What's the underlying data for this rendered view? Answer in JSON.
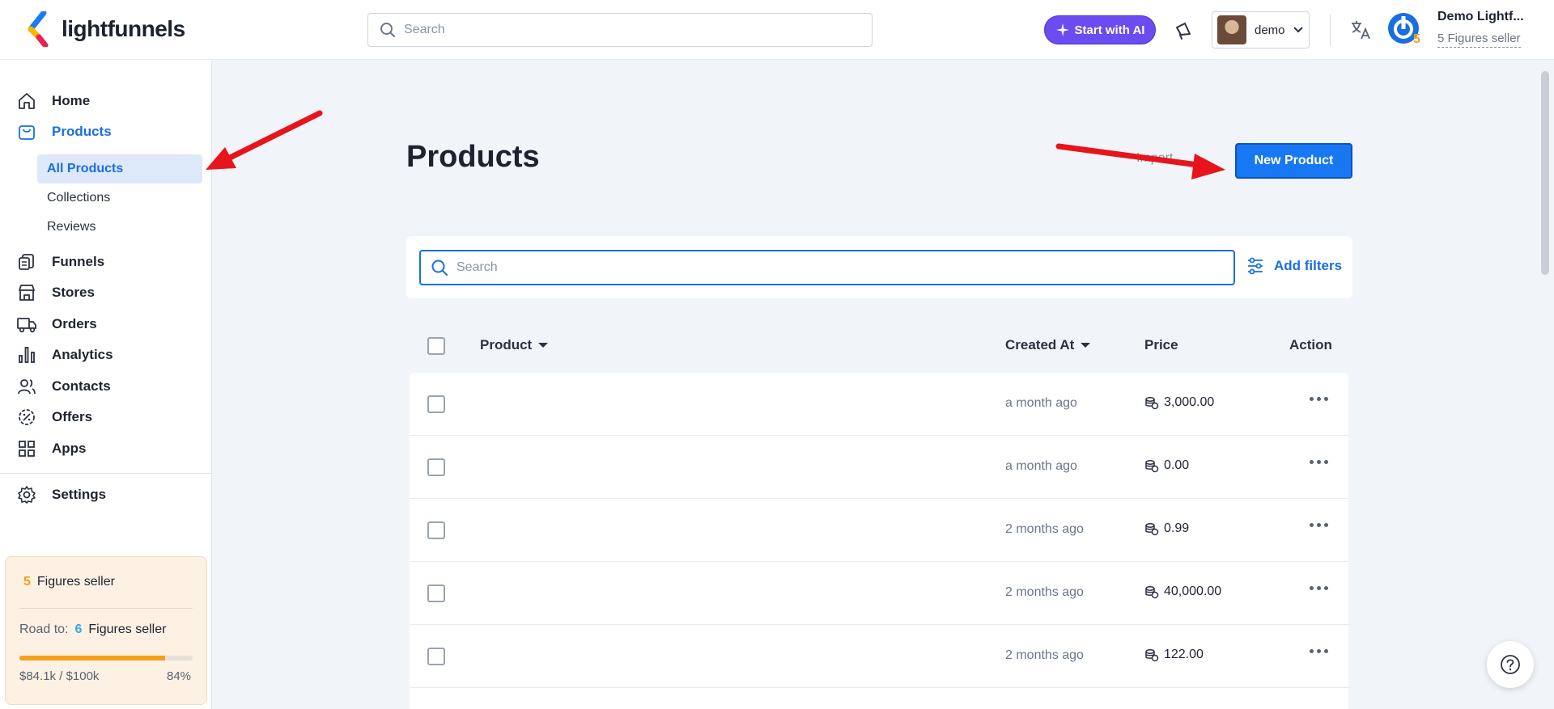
{
  "app": {
    "brand": "lightfunnels"
  },
  "topbar": {
    "search_placeholder": "Search",
    "ai_button": "Start with AI",
    "user_label": "demo",
    "account_name": "Demo Lightf...",
    "account_tier": "5 Figures seller",
    "account_badge": "5"
  },
  "sidebar": {
    "items": [
      {
        "label": "Home",
        "icon": "home-icon"
      },
      {
        "label": "Products",
        "icon": "bag-icon",
        "active": true
      },
      {
        "label": "Funnels",
        "icon": "funnels-icon"
      },
      {
        "label": "Stores",
        "icon": "store-icon"
      },
      {
        "label": "Orders",
        "icon": "truck-icon"
      },
      {
        "label": "Analytics",
        "icon": "analytics-icon"
      },
      {
        "label": "Contacts",
        "icon": "contacts-icon"
      },
      {
        "label": "Offers",
        "icon": "offers-icon"
      },
      {
        "label": "Apps",
        "icon": "apps-icon"
      },
      {
        "label": "Settings",
        "icon": "gear-icon"
      }
    ],
    "sub_items": [
      {
        "label": "All Products",
        "active": true
      },
      {
        "label": "Collections"
      },
      {
        "label": "Reviews"
      }
    ],
    "tier_card": {
      "current_num": "5",
      "current_label": "Figures seller",
      "road_label": "Road to:",
      "next_num": "6",
      "next_label": "Figures seller",
      "progress_text": "$84.1k / $100k",
      "progress_pct": "84%",
      "progress_value": 0.84
    }
  },
  "main": {
    "title": "Products",
    "import_label": "Import",
    "new_button": "New Product",
    "search_placeholder": "Search",
    "add_filters": "Add filters",
    "columns": {
      "product": "Product",
      "created_at": "Created At",
      "price": "Price",
      "action": "Action"
    },
    "rows": [
      {
        "created": "a month ago",
        "price": "3,000.00"
      },
      {
        "created": "a month ago",
        "price": "0.00"
      },
      {
        "created": "2 months ago",
        "price": "0.99"
      },
      {
        "created": "2 months ago",
        "price": "40,000.00"
      },
      {
        "created": "2 months ago",
        "price": "122.00"
      }
    ]
  },
  "colors": {
    "accent": "#1a6fe0",
    "primary_button": "#1877f2",
    "ai_button": "#6a4cf0",
    "annotation_arrow": "#e8141b",
    "progress": "#f59f1a"
  }
}
